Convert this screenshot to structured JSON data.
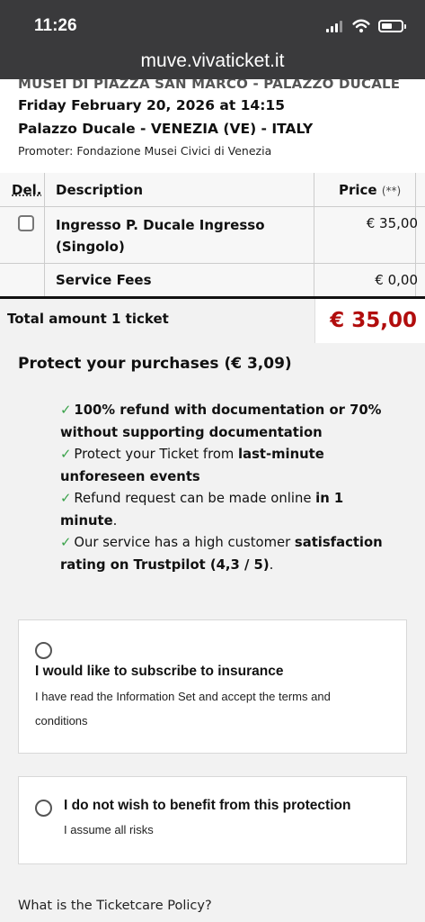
{
  "status_bar": {
    "time": "11:26",
    "icons": [
      "signal-icon",
      "wifi-icon",
      "battery-icon"
    ]
  },
  "browser": {
    "url": "muve.vivaticket.it"
  },
  "event": {
    "title": "MUSEI DI PIAZZA SAN MARCO - PALAZZO DUCALE",
    "date": "Friday February 20, 2026 at 14:15",
    "venue": "Palazzo Ducale - VENEZIA (VE) - ITALY",
    "promoter": "Promoter: Fondazione Musei Civici di Venezia"
  },
  "table": {
    "headers": {
      "delete": "Del.",
      "description": "Description",
      "price": "Price",
      "price_note": "(**)"
    },
    "rows": [
      {
        "description_line1": "Ingresso P. Ducale Ingresso",
        "description_line2": "(Singolo)",
        "price": "€ 35,00",
        "selected": false
      },
      {
        "description": "Service Fees",
        "price": "€ 0,00"
      }
    ]
  },
  "total": {
    "label": "Total amount 1 ticket",
    "amount": "€ 35,00"
  },
  "protection": {
    "title": "Protect your purchases (€ 3,09)",
    "benefits": [
      {
        "check": "✓",
        "bold_1": "100% refund with documentation or 70% without supporting documentation"
      },
      {
        "check": "✓",
        "text_1": "Protect your Ticket from ",
        "bold_1": "last-minute unforeseen events"
      },
      {
        "check": "✓",
        "text_1": "Refund request can be made online ",
        "bold_1": "in 1 minute",
        "text_2": "."
      },
      {
        "check": "✓",
        "text_1": "Our service has a high customer ",
        "bold_1": "satisfaction rating on Trustpilot (4,3 / 5)",
        "text_2": "."
      }
    ],
    "options": [
      {
        "title": "I would like to subscribe to insurance",
        "description": "I have read the Information Set and accept the terms and conditions",
        "selected": false
      },
      {
        "title": "I do not wish to benefit from this protection",
        "description": "I assume all risks",
        "selected": false
      }
    ],
    "policy_link": "What is the Ticketcare Policy?"
  },
  "colors": {
    "status_bar_background": "#3a3a3c",
    "page_background": "#f2f2f2",
    "total_price": "#b10d0d",
    "checkmark": "#3aa24a"
  }
}
